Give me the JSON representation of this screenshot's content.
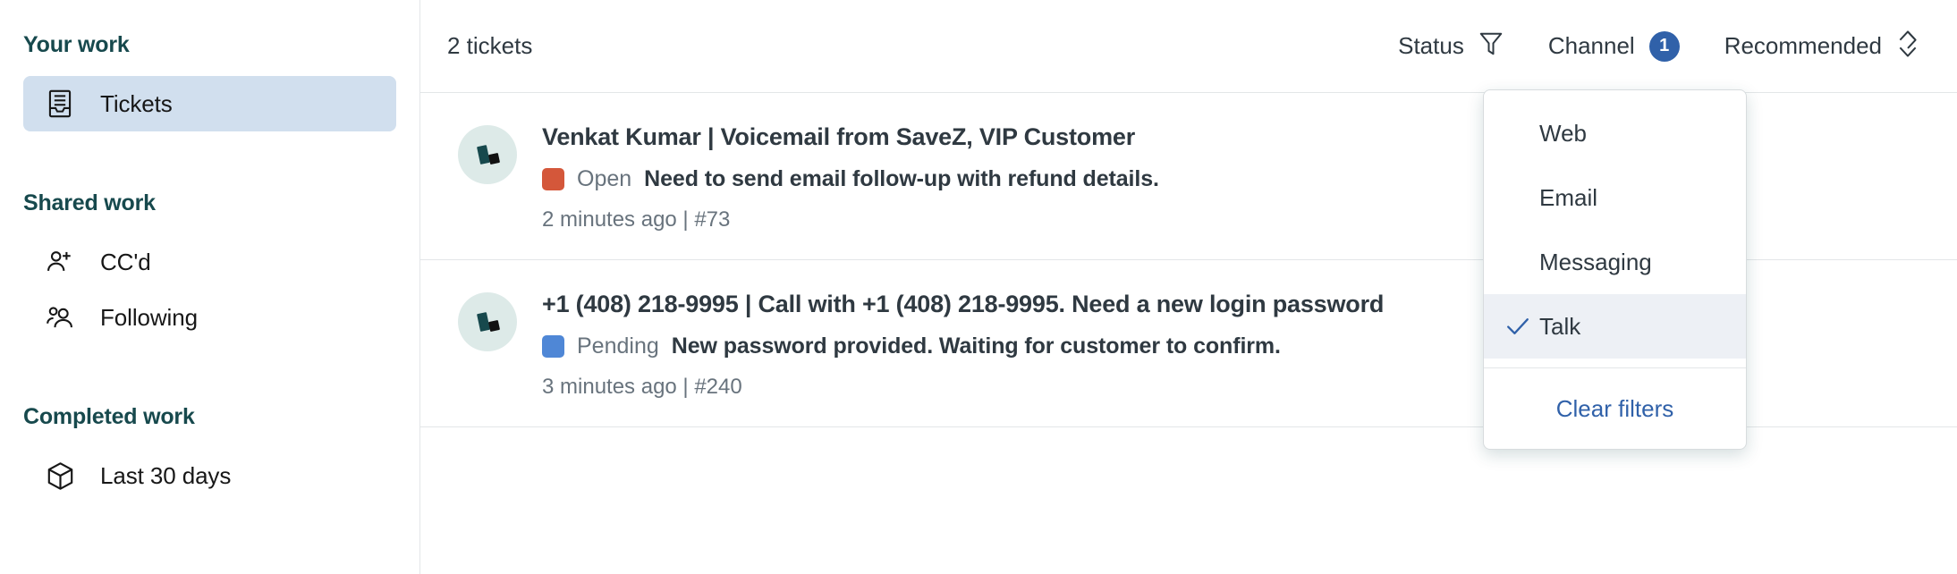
{
  "sidebar": {
    "groups": [
      {
        "heading": "Your work",
        "items": [
          {
            "label": "Tickets",
            "icon": "tickets-inbox-icon",
            "active": true
          }
        ]
      },
      {
        "heading": "Shared work",
        "items": [
          {
            "label": "CC'd",
            "icon": "person-plus-icon",
            "active": false
          },
          {
            "label": "Following",
            "icon": "people-group-icon",
            "active": false
          }
        ]
      },
      {
        "heading": "Completed work",
        "items": [
          {
            "label": "Last 30 days",
            "icon": "cube-box-icon",
            "active": false
          }
        ]
      }
    ]
  },
  "header": {
    "count_label": "2 tickets",
    "status_filter": {
      "label": "Status",
      "icon": "filter-funnel-icon"
    },
    "channel_filter": {
      "label": "Channel",
      "badge": "1"
    },
    "sort": {
      "label": "Recommended",
      "icon": "sort-chevrons-icon"
    }
  },
  "tickets": [
    {
      "avatar_icon": "zendesk-logo-avatar",
      "title": "Venkat Kumar | Voicemail from SaveZ, VIP Customer",
      "status": "Open",
      "status_color": "#D4573A",
      "snippet": "Need to send email follow-up with refund details.",
      "meta": "2 minutes ago | #73"
    },
    {
      "avatar_icon": "zendesk-logo-avatar",
      "title": "+1 (408) 218-9995 | Call with +1 (408) 218-9995. Need a new login password",
      "status": "Pending",
      "status_color": "#4F87D6",
      "snippet": "New password provided. Waiting for customer to confirm.",
      "meta": "3 minutes ago | #240"
    }
  ],
  "channel_dropdown": {
    "options": [
      {
        "label": "Web",
        "selected": false
      },
      {
        "label": "Email",
        "selected": false
      },
      {
        "label": "Messaging",
        "selected": false
      },
      {
        "label": "Talk",
        "selected": true
      }
    ],
    "clear_label": "Clear filters"
  },
  "colors": {
    "accent_blue": "#3061A9",
    "link_blue": "#3061A9",
    "sidebar_heading": "#17494D",
    "active_pill": "#D1DFEE",
    "avatar_bg": "#DDEAE8",
    "text_primary": "#2F3941",
    "text_muted": "#68737D",
    "border": "#e3e6e8"
  }
}
